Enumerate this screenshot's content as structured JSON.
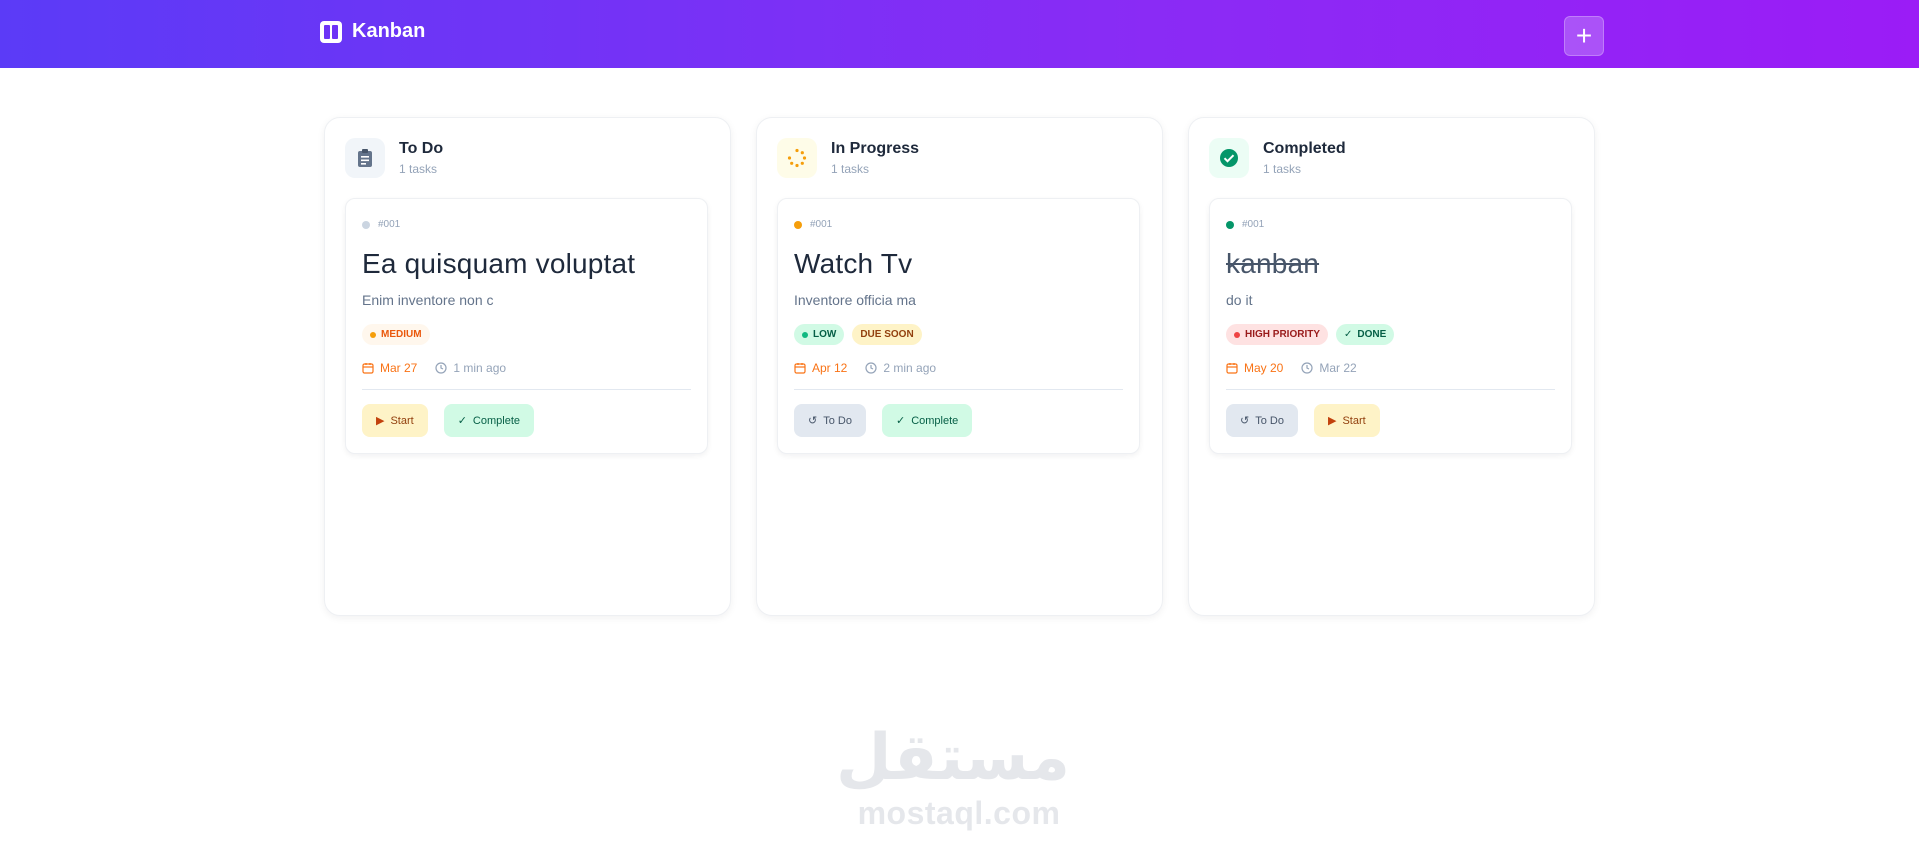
{
  "header": {
    "title": "Kanban",
    "add_label": "+"
  },
  "columns": [
    {
      "title": "To Do",
      "count": "1 tasks",
      "card": {
        "id": "#001",
        "title": "Ea quisquam voluptat",
        "description": "Enim inventore non c",
        "tags": [
          "MEDIUM"
        ],
        "date": "Mar 27",
        "ago": "1 min ago",
        "buttons": [
          "Start",
          "Complete"
        ]
      }
    },
    {
      "title": "In Progress",
      "count": "1 tasks",
      "card": {
        "id": "#001",
        "title": "Watch Tv",
        "description": "Inventore officia ma",
        "tags": [
          "LOW",
          "DUE SOON"
        ],
        "date": "Apr 12",
        "ago": "2 min ago",
        "buttons": [
          "To Do",
          "Complete"
        ]
      }
    },
    {
      "title": "Completed",
      "count": "1 tasks",
      "card": {
        "id": "#001",
        "title": "kanban",
        "description": "do it",
        "tags": [
          "HIGH PRIORITY",
          "DONE"
        ],
        "date": "May 20",
        "ago": "Mar 22",
        "buttons": [
          "To Do",
          "Start"
        ]
      }
    }
  ],
  "watermark": {
    "arabic": "مستقل",
    "latin": "mostaql.com"
  },
  "colors": {
    "accent": "#6d33f6",
    "orange": "#f97316",
    "green": "#10b981"
  }
}
